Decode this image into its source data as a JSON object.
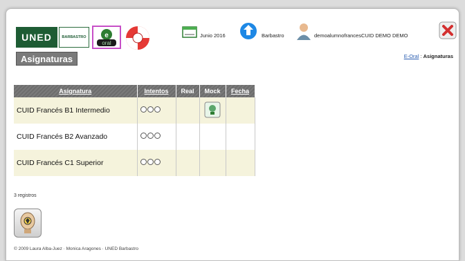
{
  "header": {
    "logo_uned": "UNED",
    "logo_barbastro": "BARBASTRO",
    "logo_eoral": "e-oral",
    "date": "Junio 2016",
    "location": "Barbastro",
    "user": "demoalumnofrancesCUID DEMO DEMO",
    "section_title": "Asignaturas",
    "breadcrumb_link": "E-Oral",
    "breadcrumb_sep": ":",
    "breadcrumb_current": "Asignaturas"
  },
  "table": {
    "columns": [
      "Asignatura",
      "Intentos",
      "Real",
      "Mock",
      "Fecha"
    ],
    "rows": [
      {
        "subject": "CUID Francés B1 Intermedio",
        "attempts_used": 0,
        "attempts_max": 3,
        "has_mock": true
      },
      {
        "subject": "CUID Francés B2 Avanzado",
        "attempts_used": 0,
        "attempts_max": 3,
        "has_mock": false
      },
      {
        "subject": "CUID Francés C1 Superior",
        "attempts_used": 0,
        "attempts_max": 3,
        "has_mock": false
      }
    ],
    "records_count": "3 registros"
  },
  "footer": {
    "credits": "© 2009 Laura Alba-Juez · Monica Aragones · UNED Barbastro"
  },
  "icons": {
    "calendar": "calendar-icon",
    "globe": "globe-icon",
    "user": "user-icon",
    "close": "close-icon",
    "lifebuoy": "lifebuoy-icon",
    "mock": "mock-exam-icon",
    "audio": "audio-head-icon"
  },
  "colors": {
    "header_bg": "#7a7a7a",
    "row_highlight": "#f5f3dc",
    "link": "#2a5db0",
    "close_red": "#d32f2f",
    "uned_green": "#1e5c34"
  }
}
